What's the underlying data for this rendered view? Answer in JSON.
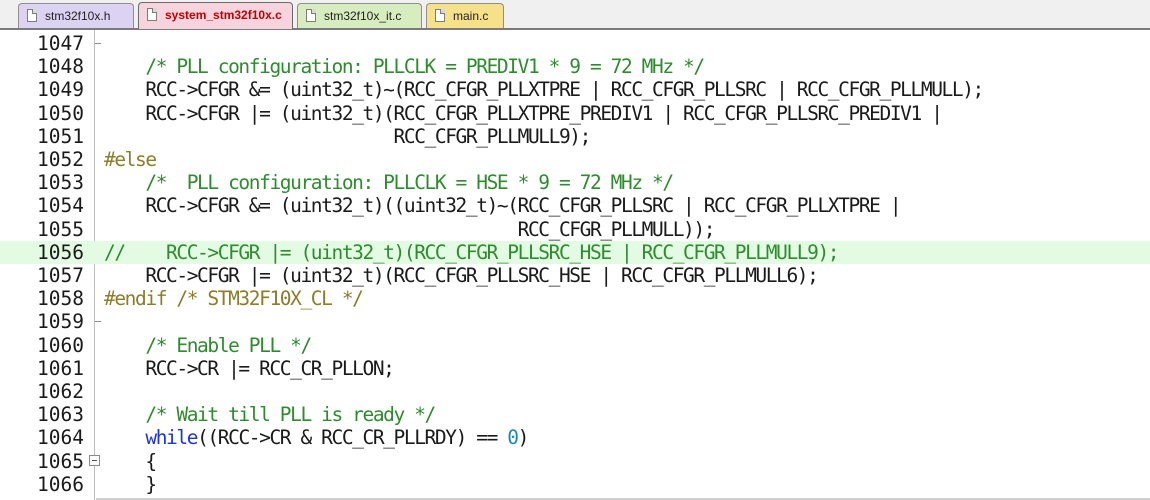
{
  "tabs": [
    {
      "label": "stm32f10x.h",
      "color": "#dcd2f2"
    },
    {
      "label": "system_stm32f10x.c",
      "color": "#f7d3de"
    },
    {
      "label": "stm32f10x_it.c",
      "color": "#d8edbf"
    },
    {
      "label": "main.c",
      "color": "#f6e08a"
    }
  ],
  "active_tab_index": 1,
  "lines": [
    {
      "num": "1047",
      "text": "",
      "style": "norm"
    },
    {
      "num": "1048",
      "text": "    /* PLL configuration: PLLCLK = PREDIV1 * 9 = 72 MHz */",
      "style": "cmt"
    },
    {
      "num": "1049",
      "text": "    RCC->CFGR &= (uint32_t)~(RCC_CFGR_PLLXTPRE | RCC_CFGR_PLLSRC | RCC_CFGR_PLLMULL);",
      "style": "norm"
    },
    {
      "num": "1050",
      "text": "    RCC->CFGR |= (uint32_t)(RCC_CFGR_PLLXTPRE_PREDIV1 | RCC_CFGR_PLLSRC_PREDIV1 |",
      "style": "norm"
    },
    {
      "num": "1051",
      "text": "                            RCC_CFGR_PLLMULL9);",
      "style": "norm"
    },
    {
      "num": "1052",
      "text": "#else",
      "style": "pp"
    },
    {
      "num": "1053",
      "text": "    /*  PLL configuration: PLLCLK = HSE * 9 = 72 MHz */",
      "style": "cmt"
    },
    {
      "num": "1054",
      "text": "    RCC->CFGR &= (uint32_t)((uint32_t)~(RCC_CFGR_PLLSRC | RCC_CFGR_PLLXTPRE |",
      "style": "norm"
    },
    {
      "num": "1055",
      "text": "                                        RCC_CFGR_PLLMULL));",
      "style": "norm"
    },
    {
      "num": "1056",
      "text": "//    RCC->CFGR |= (uint32_t)(RCC_CFGR_PLLSRC_HSE | RCC_CFGR_PLLMULL9);",
      "style": "cmt",
      "highlight": true
    },
    {
      "num": "1057",
      "text": "    RCC->CFGR |= (uint32_t)(RCC_CFGR_PLLSRC_HSE | RCC_CFGR_PLLMULL6);",
      "style": "norm"
    },
    {
      "num": "1058",
      "text": "#endif /* STM32F10X_CL */",
      "style": "pp"
    },
    {
      "num": "1059",
      "text": "",
      "style": "norm"
    },
    {
      "num": "1060",
      "text": "    /* Enable PLL */",
      "style": "cmt"
    },
    {
      "num": "1061",
      "text": "    RCC->CR |= RCC_CR_PLLON;",
      "style": "norm"
    },
    {
      "num": "1062",
      "text": "",
      "style": "norm"
    },
    {
      "num": "1063",
      "text": "    /* Wait till PLL is ready */",
      "style": "cmt"
    },
    {
      "num": "1064",
      "text": "    while((RCC->CR & RCC_CR_PLLRDY) == 0)",
      "style": "norm",
      "tokens": [
        {
          "t": "    ",
          "c": "norm"
        },
        {
          "t": "while",
          "c": "kw"
        },
        {
          "t": "((RCC->CR & RCC_CR_PLLRDY) == ",
          "c": "norm"
        },
        {
          "t": "0",
          "c": "num"
        },
        {
          "t": ")",
          "c": "norm"
        }
      ]
    },
    {
      "num": "1065",
      "text": "    {",
      "style": "norm"
    },
    {
      "num": "1066",
      "text": "    }",
      "style": "norm"
    }
  ],
  "fold_markers": {
    "1047": "tick",
    "1059": "tick",
    "1065": "box"
  }
}
